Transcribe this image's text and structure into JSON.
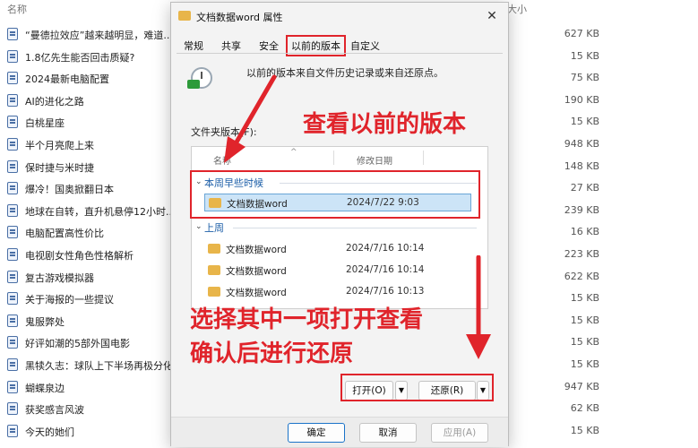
{
  "explorer": {
    "header_name": "名称",
    "header_size": "大小",
    "files": [
      {
        "name": "“曼德拉效应”越来越明显，难道...",
        "size": "627 KB"
      },
      {
        "name": "1.8亿先生能否回击质疑?",
        "size": "15 KB"
      },
      {
        "name": "2024最新电脑配置",
        "size": "75 KB"
      },
      {
        "name": "AI的进化之路",
        "size": "190 KB"
      },
      {
        "name": "白桃星座",
        "size": "15 KB"
      },
      {
        "name": "半个月亮爬上来",
        "size": "948 KB"
      },
      {
        "name": "保时捷与米时捷",
        "size": "148 KB"
      },
      {
        "name": "爆冷！国奥掀翻日本",
        "size": "27 KB"
      },
      {
        "name": "地球在自转，直升机悬停12小时...",
        "size": "239 KB"
      },
      {
        "name": "电脑配置高性价比",
        "size": "16 KB"
      },
      {
        "name": "电视剧女性角色性格解析",
        "size": "223 KB"
      },
      {
        "name": "复古游戏模拟器",
        "size": "622 KB"
      },
      {
        "name": "关于海报的一些提议",
        "size": "15 KB"
      },
      {
        "name": "鬼服弊处",
        "size": "15 KB"
      },
      {
        "name": "好评如潮的5部外国电影",
        "size": "15 KB"
      },
      {
        "name": "黑犊久志：球队上下半场再极分化",
        "size": "15 KB"
      },
      {
        "name": "蝴蝶泉边",
        "size": "947 KB"
      },
      {
        "name": "获奖感言风波",
        "size": "62 KB"
      },
      {
        "name": "今天的她们",
        "size": "15 KB"
      }
    ]
  },
  "dialog": {
    "title": "文档数据word 属性",
    "close_glyph": "✕",
    "tabs": [
      "常规",
      "共享",
      "安全",
      "以前的版本",
      "自定义"
    ],
    "description": "以前的版本来自文件历史记录或来自还原点。",
    "folder_versions_label": "文件夹版本(F):",
    "columns": {
      "name": "名称",
      "date": "修改日期",
      "sort_glyph": "^"
    },
    "groups": [
      {
        "label": "本周早些时候",
        "chevron": "⌄",
        "rows": [
          {
            "name": "文档数据word",
            "date": "2024/7/22 9:03"
          }
        ]
      },
      {
        "label": "上周",
        "chevron": "⌄",
        "rows": [
          {
            "name": "文档数据word",
            "date": "2024/7/16 10:14"
          },
          {
            "name": "文档数据word",
            "date": "2024/7/16 10:14"
          },
          {
            "name": "文档数据word",
            "date": "2024/7/16 10:13"
          }
        ]
      }
    ],
    "buttons": {
      "open": "打开(O)",
      "restore": "还原(R)",
      "dropdown_glyph": "▼",
      "ok": "确定",
      "cancel": "取消",
      "apply": "应用(A)"
    }
  },
  "annotations": {
    "text_1": "查看以前的版本",
    "text_2": "选择其中一项打开查看",
    "text_3": "确认后进行还原",
    "color": "#e0242b"
  }
}
